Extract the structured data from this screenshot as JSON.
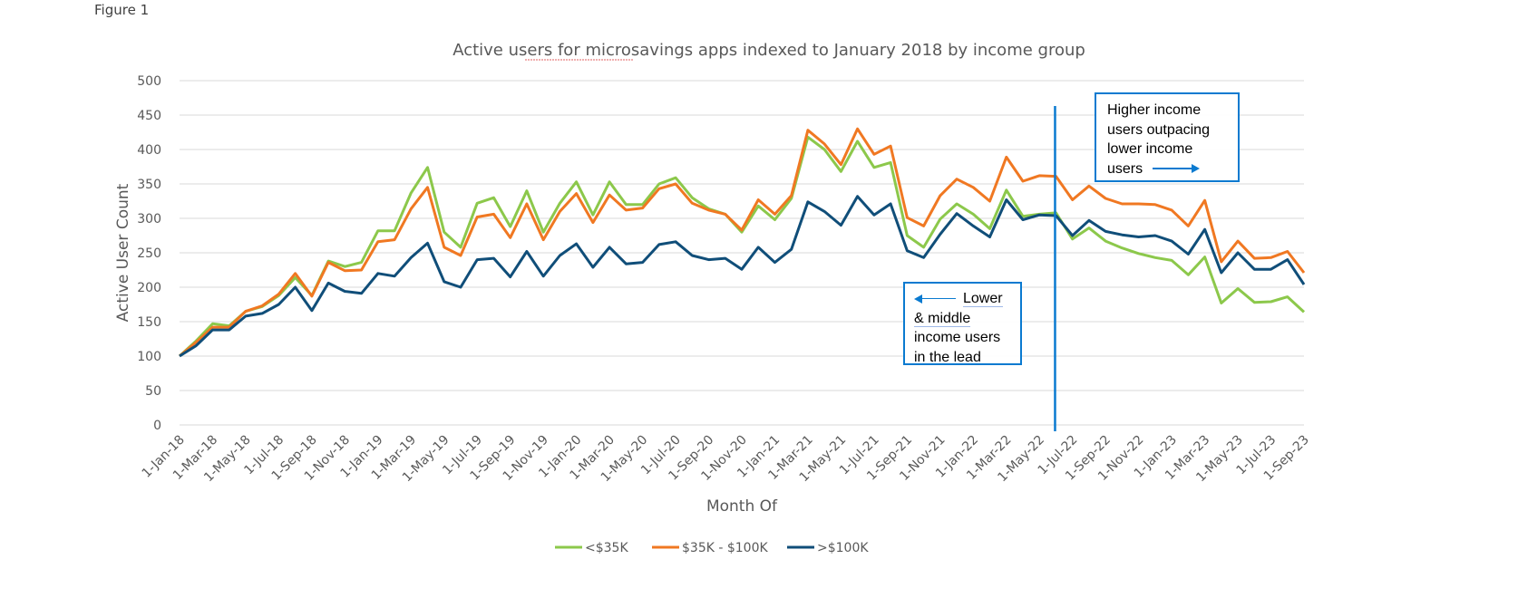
{
  "figure_label": "Figure 1",
  "chart_data": {
    "type": "line",
    "title": "Active users for microsavings apps indexed to January 2018 by income group",
    "title_parts": [
      "Active users for ",
      "microsavings",
      " apps indexed to January 2018 by income group"
    ],
    "xlabel": "Month Of",
    "ylabel": "Active User Count",
    "ylim": [
      0,
      500
    ],
    "yticks": [
      0,
      50,
      100,
      150,
      200,
      250,
      300,
      350,
      400,
      450,
      500
    ],
    "grid": true,
    "legend_position": "bottom",
    "x": [
      "Jan-18",
      "Feb-18",
      "Mar-18",
      "Apr-18",
      "May-18",
      "Jun-18",
      "Jul-18",
      "Aug-18",
      "Sep-18",
      "Oct-18",
      "Nov-18",
      "Dec-18",
      "Jan-19",
      "Feb-19",
      "Mar-19",
      "Apr-19",
      "May-19",
      "Jun-19",
      "Jul-19",
      "Aug-19",
      "Sep-19",
      "Oct-19",
      "Nov-19",
      "Dec-19",
      "Jan-20",
      "Feb-20",
      "Mar-20",
      "Apr-20",
      "May-20",
      "Jun-20",
      "Jul-20",
      "Aug-20",
      "Sep-20",
      "Oct-20",
      "Nov-20",
      "Dec-20",
      "Jan-21",
      "Feb-21",
      "Mar-21",
      "Apr-21",
      "May-21",
      "Jun-21",
      "Jul-21",
      "Aug-21",
      "Sep-21",
      "Oct-21",
      "Nov-21",
      "Dec-21",
      "Jan-22",
      "Feb-22",
      "Mar-22",
      "Apr-22",
      "May-22",
      "Jun-22",
      "Jul-22",
      "Aug-22",
      "Sep-22",
      "Oct-22",
      "Nov-22",
      "Dec-22",
      "Jan-23",
      "Feb-23",
      "Mar-23",
      "Apr-23",
      "May-23",
      "Jun-23",
      "Jul-23",
      "Aug-23",
      "Sep-23"
    ],
    "xtick_labels": [
      "1-Jan-18",
      "1-Mar-18",
      "1-May-18",
      "1-Jul-18",
      "1-Sep-18",
      "1-Nov-18",
      "1-Jan-19",
      "1-Mar-19",
      "1-May-19",
      "1-Jul-19",
      "1-Sep-19",
      "1-Nov-19",
      "1-Jan-20",
      "1-Mar-20",
      "1-May-20",
      "1-Jul-20",
      "1-Sep-20",
      "1-Nov-20",
      "1-Jan-21",
      "1-Mar-21",
      "1-May-21",
      "1-Jul-21",
      "1-Sep-21",
      "1-Nov-21",
      "1-Jan-22",
      "1-Mar-22",
      "1-May-22",
      "1-Jul-22",
      "1-Sep-22",
      "1-Nov-22",
      "1-Jan-23",
      "1-Mar-23",
      "1-May-23",
      "1-Jul-23",
      "1-Sep-23"
    ],
    "series": [
      {
        "name": "<$35K",
        "color": "#8cc84b",
        "values": [
          100,
          122,
          147,
          144,
          165,
          172,
          188,
          214,
          188,
          238,
          230,
          236,
          282,
          282,
          337,
          374,
          280,
          258,
          322,
          330,
          288,
          340,
          280,
          322,
          353,
          305,
          353,
          320,
          320,
          350,
          359,
          330,
          314,
          306,
          280,
          318,
          298,
          329,
          418,
          400,
          368,
          412,
          374,
          381,
          275,
          258,
          299,
          321,
          306,
          285,
          341,
          303,
          306,
          308,
          270,
          286,
          267,
          257,
          249,
          243,
          239,
          218,
          244,
          177,
          198,
          178,
          179,
          186,
          164
        ]
      },
      {
        "name": "$35K - $100K",
        "color": "#f07822",
        "values": [
          100,
          120,
          142,
          142,
          165,
          173,
          190,
          220,
          187,
          236,
          224,
          225,
          266,
          269,
          314,
          345,
          258,
          246,
          302,
          306,
          272,
          321,
          269,
          310,
          336,
          294,
          334,
          312,
          315,
          343,
          350,
          322,
          312,
          306,
          283,
          327,
          306,
          333,
          428,
          408,
          378,
          430,
          393,
          405,
          301,
          289,
          333,
          357,
          345,
          325,
          389,
          354,
          362,
          361,
          327,
          347,
          329,
          321,
          321,
          320,
          312,
          289,
          326,
          237,
          267,
          242,
          243,
          252,
          221
        ]
      },
      {
        "name": ">$100K",
        "color": "#104e79",
        "values": [
          100,
          115,
          138,
          138,
          158,
          162,
          175,
          200,
          166,
          206,
          194,
          191,
          220,
          216,
          243,
          264,
          208,
          200,
          240,
          242,
          215,
          252,
          216,
          246,
          263,
          229,
          258,
          234,
          236,
          262,
          266,
          246,
          240,
          242,
          226,
          258,
          236,
          255,
          324,
          310,
          290,
          332,
          305,
          321,
          253,
          243,
          277,
          307,
          289,
          273,
          327,
          298,
          305,
          304,
          275,
          297,
          281,
          276,
          273,
          275,
          267,
          248,
          284,
          221,
          250,
          226,
          226,
          240,
          204
        ]
      }
    ],
    "reference_line": {
      "x": "Jun-22",
      "color": "#0a7ad0"
    },
    "annotations": [
      {
        "id": "lower",
        "lines": [
          "Lower",
          "& middle",
          "income users",
          "in the lead"
        ],
        "arrow": "left"
      },
      {
        "id": "higher",
        "lines": [
          "Higher income",
          "users outpacing",
          "lower income",
          "users"
        ],
        "arrow": "right"
      }
    ]
  },
  "colors": {
    "accent": "#0a7ad0",
    "grid": "#d9d9d9",
    "text": "#595959"
  }
}
